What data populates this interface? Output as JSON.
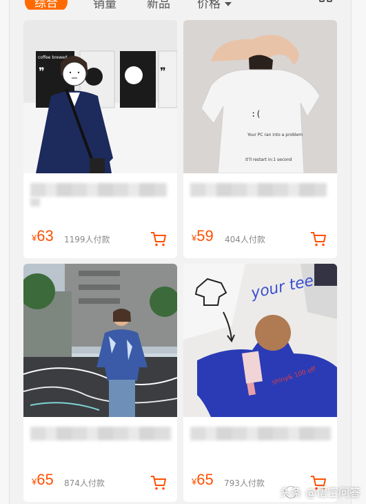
{
  "sort_bar": {
    "tabs": [
      "综合",
      "销量",
      "新品",
      "价格"
    ]
  },
  "products": [
    {
      "price_currency": "¥",
      "price": "63",
      "paid": "1199人付款",
      "shirt_text": "",
      "photo_text_1": "coffee brewed",
      "photo_text_2": ""
    },
    {
      "price_currency": "¥",
      "price": "59",
      "paid": "404人付款",
      "shirt_text": ":(",
      "photo_text_1": "Your PC ran into a problem",
      "photo_text_2": "it'll restart in:1 second"
    },
    {
      "price_currency": "¥",
      "price": "65",
      "paid": "874人付款",
      "shirt_text": "",
      "photo_text_1": "",
      "photo_text_2": ""
    },
    {
      "price_currency": "¥",
      "price": "65",
      "paid": "793人付款",
      "shirt_text": "your tee",
      "photo_text_1": "shiny& 100 off",
      "photo_text_2": ""
    }
  ],
  "watermark": "头条 @悟空问答",
  "colors": {
    "accent": "#ff5000",
    "tab_active": "#ff6a00",
    "navy_shirt": "#1d2a5c",
    "blue_tee": "#2a3bb5"
  }
}
